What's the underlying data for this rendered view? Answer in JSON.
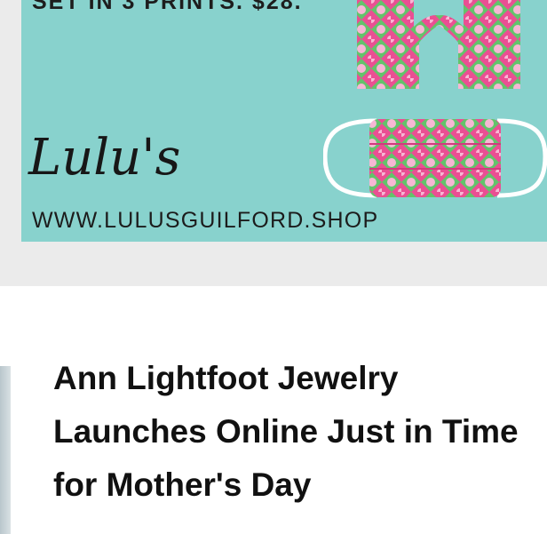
{
  "ad": {
    "headline": "SET IN 3 PRINTS. $28.",
    "brand": "Lulu's",
    "url": "WWW.LULUSGUILFORD.SHOP",
    "background_color": "#88d2cd",
    "print_colors": [
      "#e83e8c",
      "#5cb85c"
    ]
  },
  "article": {
    "title": "Ann Lightfoot Jewelry Launches Online Just in Time for Mother's Day"
  }
}
